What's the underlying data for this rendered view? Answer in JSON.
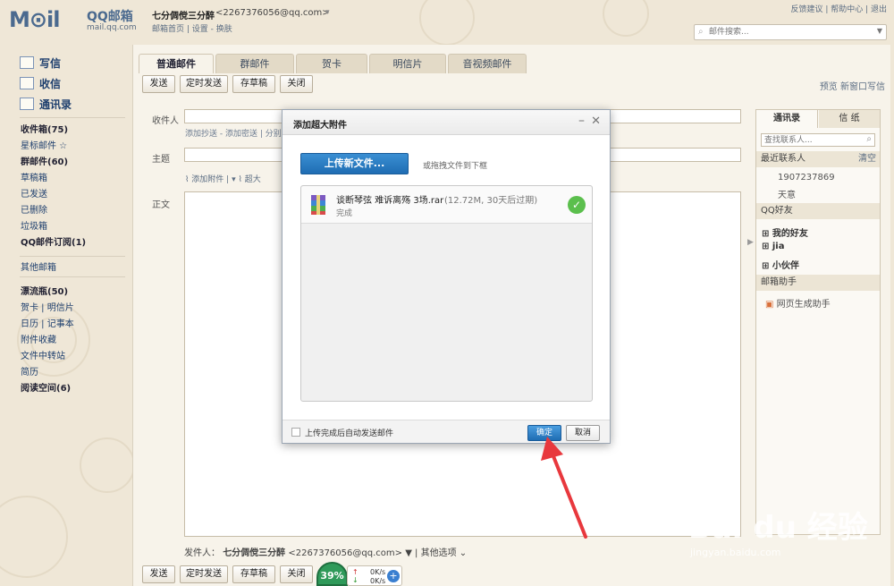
{
  "header": {
    "logo_m": "M⊙il",
    "logo_qq": "QQ邮箱",
    "logo_url": "mail.qq.com",
    "user_name": "七分倜傥三分醉",
    "user_email": "<2267376056@qq.com>",
    "links": "邮箱首页 | 设置 - 换肤",
    "top_links": "反馈建议 | 帮助中心 | 退出",
    "search_placeholder": "邮件搜索..."
  },
  "sidebar": {
    "compose": "写信",
    "inbox": "收信",
    "contacts": "通讯录",
    "items": [
      {
        "label": "收件箱(75)",
        "bold": true
      },
      {
        "label": "星标邮件 ☆",
        "bold": false
      },
      {
        "label": "群邮件(60)",
        "bold": true
      },
      {
        "label": "草稿箱",
        "bold": false
      },
      {
        "label": "已发送",
        "bold": false
      },
      {
        "label": "已删除",
        "bold": false
      },
      {
        "label": "垃圾箱",
        "bold": false
      },
      {
        "label": "QQ邮件订阅(1)",
        "bold": true
      }
    ],
    "other": "其他邮箱",
    "items2": [
      {
        "label": "漂流瓶(50)",
        "bold": true
      },
      {
        "label": "贺卡 | 明信片",
        "bold": false
      },
      {
        "label": "日历 | 记事本",
        "bold": false
      },
      {
        "label": "附件收藏",
        "bold": false
      },
      {
        "label": "文件中转站",
        "bold": false
      },
      {
        "label": "简历",
        "bold": false
      },
      {
        "label": "阅读空间(6)",
        "bold": true
      }
    ]
  },
  "tabs": [
    "普通邮件",
    "群邮件",
    "贺卡",
    "明信片",
    "音视频邮件"
  ],
  "toolbar": {
    "send": "发送",
    "timed": "定时发送",
    "draft": "存草稿",
    "close": "关闭"
  },
  "preview_links": "预览  新窗口写信",
  "form": {
    "to_label": "收件人",
    "cc_links": "添加抄送 - 添加密送 | 分别",
    "subject_label": "主题",
    "attach_add": "添加附件",
    "attach_big": "超大",
    "body_label": "正文"
  },
  "sender": {
    "label": "发件人：",
    "name": "七分倜傥三分醉",
    "email": "<2267376056@qq.com>",
    "more": "其他选项"
  },
  "right_panel": {
    "tab_contacts": "通讯录",
    "tab_letter": "信 纸",
    "search_placeholder": "查找联系人...",
    "recent": "最近联系人",
    "clear": "清空",
    "recent_items": [
      "1907237869",
      "天意"
    ],
    "qq_friends": "QQ好友",
    "groups": [
      "我的好友",
      "jia",
      "小伙伴"
    ],
    "assistant": "邮箱助手",
    "assistant_item": "网页生成助手"
  },
  "dialog": {
    "title": "添加超大附件",
    "upload": "上传新文件...",
    "drag_hint": "或拖拽文件到下框",
    "file_name": "谈断琴弦 难诉离殇 3场.rar",
    "file_meta": "(12.72M, 30天后过期)",
    "file_status": "完成",
    "auto_send": "上传完成后自动发送邮件",
    "ok": "确定",
    "cancel": "取消"
  },
  "speed": {
    "percent": "39%",
    "up": "0K/s",
    "down": "0K/s"
  },
  "watermark": {
    "text": "Bai du 经验",
    "url": "jingyan.baidu.com"
  },
  "colors": {
    "accent": "#1f6db3",
    "background": "#efe7d7",
    "success": "#5bbf4d",
    "arrow": "#e8383d"
  }
}
